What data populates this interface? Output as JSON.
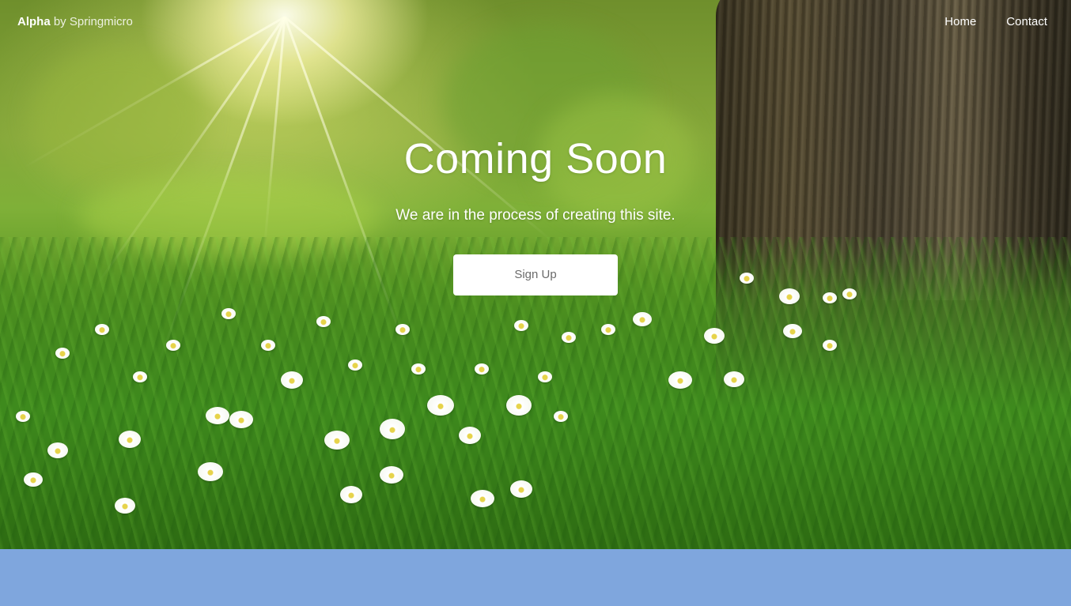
{
  "header": {
    "brand_name": "Alpha",
    "brand_suffix": "by Springmicro",
    "nav": [
      {
        "label": "Home"
      },
      {
        "label": "Contact"
      }
    ]
  },
  "hero": {
    "title": "Coming Soon",
    "subtitle": "We are in the process of creating this site.",
    "cta_label": "Sign Up",
    "background": "meadow-with-tree-and-white-flowers"
  },
  "footer": {
    "color": "#7fa6dd"
  },
  "colors": {
    "text": "#ffffff",
    "button_bg": "#ffffff",
    "button_text": "#6b6b6b"
  }
}
